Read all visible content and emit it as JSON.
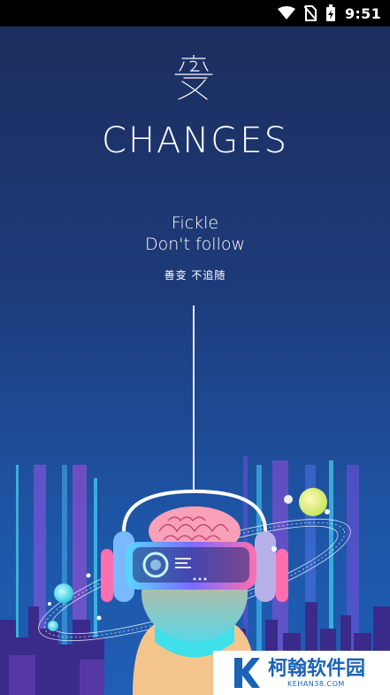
{
  "status_bar": {
    "time": "9:51",
    "icons": [
      "wifi-icon",
      "no-sim-icon",
      "battery-charging-icon"
    ]
  },
  "logo": {
    "glyph": "变",
    "icon": "changes-logo-mark"
  },
  "splash": {
    "title": "CHANGES",
    "tagline_line1": "Fickle",
    "tagline_line2": "Don't follow",
    "subtitle": "善变 不追随"
  },
  "illustration": {
    "name": "vr-headset-illustration",
    "icon": "vr-person-icon"
  },
  "watermark": {
    "text_cn": "柯翰软件园",
    "text_en": "KEHAN38.COM",
    "icon": "k-logo-icon"
  },
  "colors": {
    "bg_top": "#1c2d5c",
    "bg_bottom": "#1f5fb5",
    "accent_pink": "#ff6fb0",
    "accent_cyan": "#39e0f0",
    "watermark_blue": "#1a63b8"
  }
}
